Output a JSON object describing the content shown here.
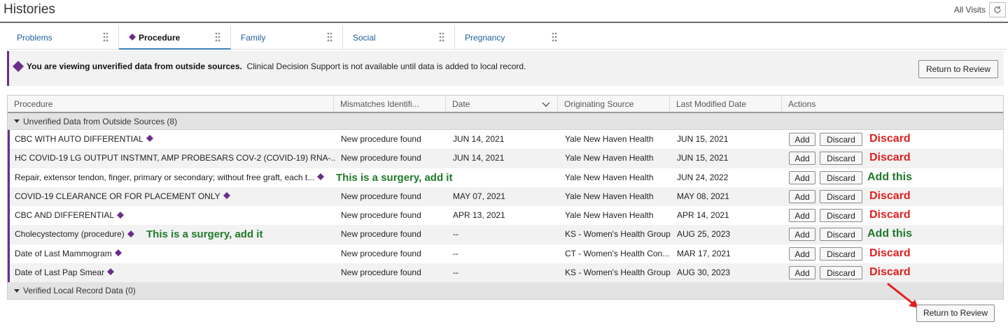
{
  "header": {
    "title": "Histories",
    "all_visits": "All Visits"
  },
  "tabs": [
    {
      "label": "Problems"
    },
    {
      "label": "Procedure"
    },
    {
      "label": "Family"
    },
    {
      "label": "Social"
    },
    {
      "label": "Pregnancy"
    }
  ],
  "banner": {
    "bold_text": "You are viewing unverified data from outside sources.",
    "text": "Clinical Decision Support is not available until data is added to local record.",
    "button_label": "Return to Review"
  },
  "grid": {
    "columns": [
      "Procedure",
      "Mismatches Identifi...",
      "Date",
      "Originating Source",
      "Last Modified Date",
      "Actions"
    ],
    "unverified_group": "Unverified Data from Outside Sources (8)",
    "verified_group": "Verified Local Record Data (0)",
    "add_label": "Add",
    "discard_label": "Discard",
    "rows": [
      {
        "procedure": "CBC WITH AUTO DIFFERENTIAL",
        "mismatch": "New procedure found",
        "date": "JUN 14, 2021",
        "source": "Yale New Haven Health",
        "modified": "JUN 15, 2021",
        "note": "Discard"
      },
      {
        "procedure": "HC COVID-19 LG OUTPUT INSTMNT, AMP PROBESARS COV-2 (COVID-19) RNA-...",
        "mismatch": "New procedure found",
        "date": "JUN 14, 2021",
        "source": "Yale New Haven Health",
        "modified": "JUN 15, 2021",
        "note": "Discard"
      },
      {
        "procedure": "Repair, extensor tendon, finger, primary or secondary; without free graft, each t...",
        "mismatch": "",
        "date": "",
        "source": "Yale New Haven Health",
        "modified": "JUN 24, 2022",
        "note": "Add this",
        "inline_note": "This is a surgery, add it"
      },
      {
        "procedure": "COVID-19 CLEARANCE OR FOR PLACEMENT ONLY",
        "mismatch": "New procedure found",
        "date": "MAY 07, 2021",
        "source": "Yale New Haven Health",
        "modified": "MAY 08, 2021",
        "note": "Discard"
      },
      {
        "procedure": "CBC AND DIFFERENTIAL",
        "mismatch": "New procedure found",
        "date": "APR 13, 2021",
        "source": "Yale New Haven Health",
        "modified": "APR 14, 2021",
        "note": "Discard"
      },
      {
        "procedure": "Cholecystectomy (procedure)",
        "mismatch": "New procedure found",
        "date": "--",
        "source": "KS - Women's Health Group",
        "modified": "AUG 25, 2023",
        "note": "Add this",
        "inline_note": "This is a surgery, add it"
      },
      {
        "procedure": "Date of Last Mammogram",
        "mismatch": "New procedure found",
        "date": "--",
        "source": "CT - Women's Health Con...",
        "modified": "MAR 17, 2021",
        "note": "Discard"
      },
      {
        "procedure": "Date of Last Pap Smear",
        "mismatch": "New procedure found",
        "date": "--",
        "source": "KS - Women's Health Group",
        "modified": "AUG 30, 2023",
        "note": "Discard"
      }
    ]
  },
  "bottom_button_label": "Return to Review",
  "colors": {
    "accent_purple": "#6a2d8c",
    "note_red": "#e02020",
    "note_green": "#1f7a2a",
    "link_blue": "#1f5fa0"
  }
}
